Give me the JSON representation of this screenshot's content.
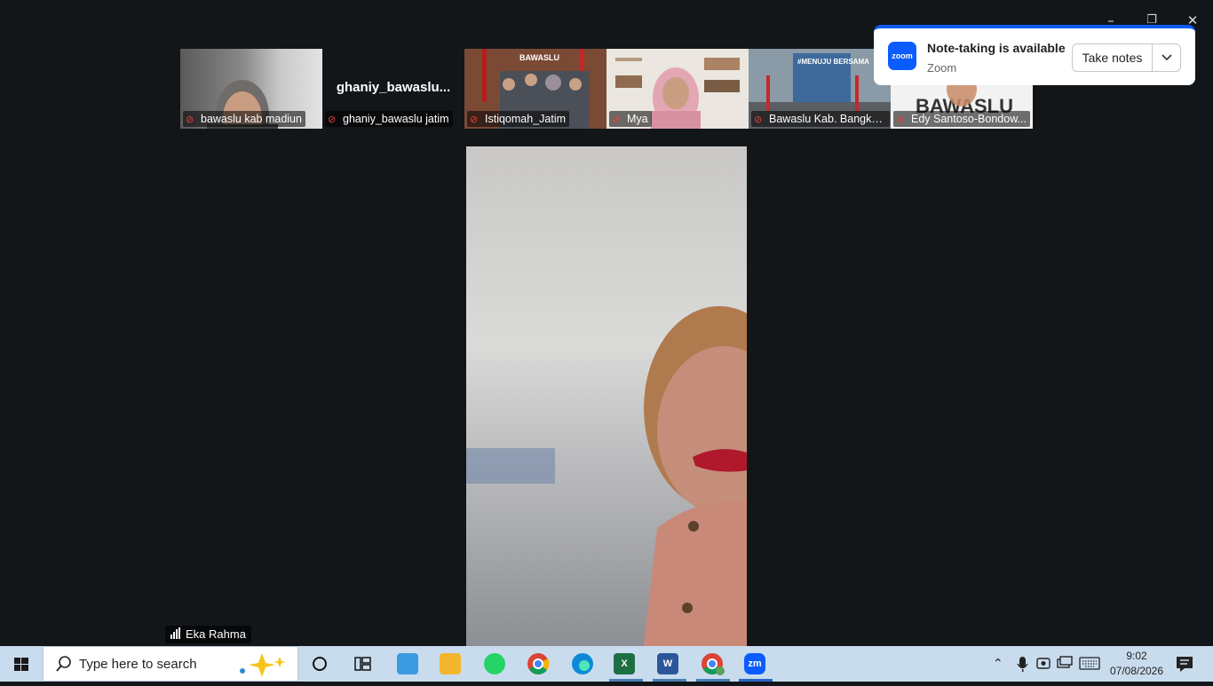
{
  "window": {
    "minimize_glyph": "–",
    "restore_glyph": "❐",
    "close_glyph": "✕"
  },
  "participants": [
    {
      "name": "bawaslu kab madiun",
      "muted": true,
      "video": true
    },
    {
      "name": "ghaniy_bawaslu jatim",
      "display_name": "ghaniy_bawaslu...",
      "muted": true,
      "video": false
    },
    {
      "name": "Istiqomah_Jatim",
      "muted": true,
      "video": true
    },
    {
      "name": "Mya",
      "muted": true,
      "video": true
    },
    {
      "name": "Bawaslu Kab. Bangkal...",
      "muted": true,
      "video": true
    },
    {
      "name": "Edy Santoso-Bondow...",
      "muted": true,
      "video": true
    }
  ],
  "tile_texts": {
    "banner_bawaslu_small": "BAWASLU",
    "banner_bawaslu_big": "BAWASLU",
    "banner_event": "#MENUJU BERSAMA"
  },
  "active_speaker": {
    "name": "Eka Rahma"
  },
  "notification": {
    "title": "Note-taking is available",
    "app": "Zoom",
    "logo_text": "zoom",
    "button_label": "Take notes"
  },
  "taskbar": {
    "search_placeholder": "Type here to search",
    "apps": [
      {
        "name": "Cortana",
        "icon": "circle-icon"
      },
      {
        "name": "Task View",
        "icon": "task-view-icon"
      },
      {
        "name": "Control Panel",
        "icon": "control-panel-icon"
      },
      {
        "name": "File Explorer",
        "icon": "folder-icon"
      },
      {
        "name": "WhatsApp",
        "icon": "whatsapp-icon"
      },
      {
        "name": "Chrome",
        "icon": "chrome-icon"
      },
      {
        "name": "Edge",
        "icon": "edge-icon"
      },
      {
        "name": "Excel",
        "icon": "excel-icon",
        "letter": "X"
      },
      {
        "name": "Word",
        "icon": "word-icon",
        "letter": "W"
      },
      {
        "name": "Chrome profile",
        "icon": "chrome-profile-icon"
      },
      {
        "name": "Zoom",
        "icon": "zoom-icon",
        "letter": "zm"
      }
    ],
    "time": "9:02",
    "date": "07/08/2026"
  },
  "colors": {
    "zoom_blue": "#0b5cff",
    "meeting_bg": "#131619",
    "taskbar_bg": "#c9dcee",
    "muted_red": "#e5413b"
  }
}
